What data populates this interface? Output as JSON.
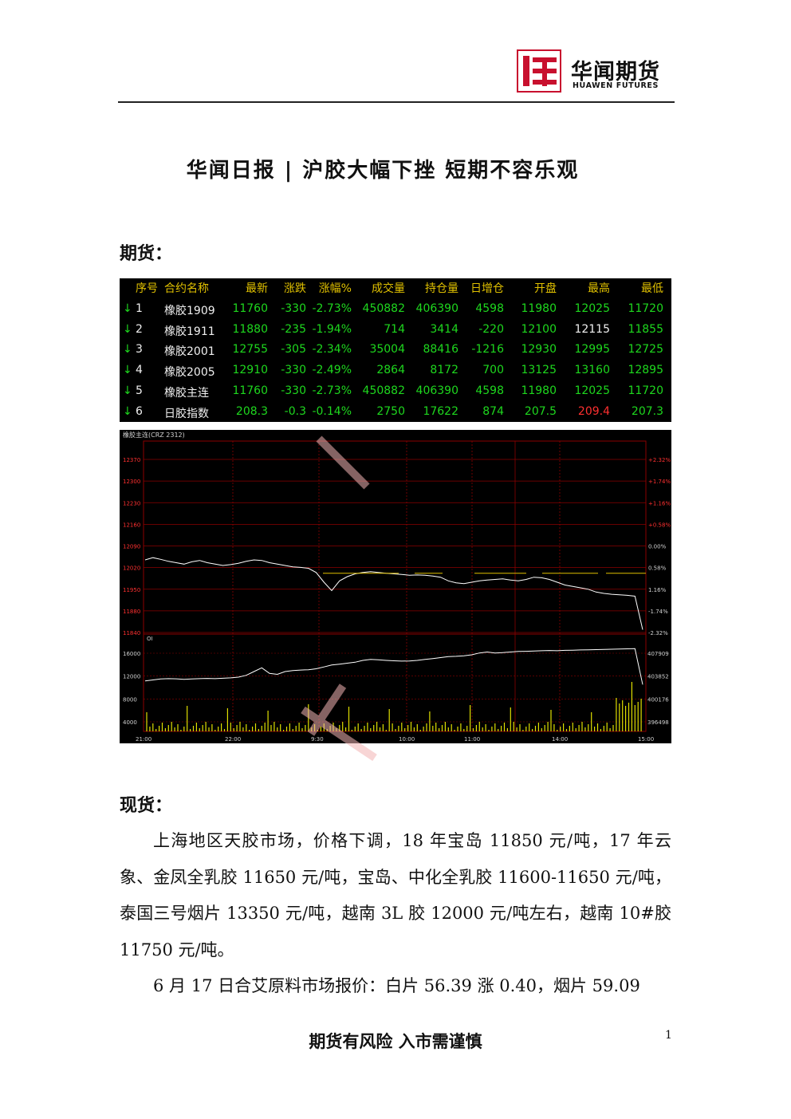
{
  "header": {
    "logo_cn": "华闻期货",
    "logo_en": "HUAWEN FUTURES",
    "brand_color": "#c8102e"
  },
  "title": "华闻日报 | 沪胶大幅下挫 短期不容乐观",
  "futures_heading": "期货：",
  "quote_table": {
    "columns": [
      "序号",
      "合约名称",
      "最新",
      "涨跌",
      "涨幅%",
      "成交量",
      "持仓量",
      "日增仓",
      "开盘",
      "最高",
      "最低"
    ],
    "rows": [
      {
        "arrow": "↓",
        "no": "1",
        "name": "橡胶1909",
        "last": "11760",
        "chg": "-330",
        "pct": "-2.73%",
        "vol": "450882",
        "oi": "406390",
        "doi": "4598",
        "open": "11980",
        "high": "12025",
        "low": "11720"
      },
      {
        "arrow": "↓",
        "no": "2",
        "name": "橡胶1911",
        "last": "11880",
        "chg": "-235",
        "pct": "-1.94%",
        "vol": "714",
        "oi": "3414",
        "doi": "-220",
        "open": "12100",
        "high": "12115",
        "low": "11855"
      },
      {
        "arrow": "↓",
        "no": "3",
        "name": "橡胶2001",
        "last": "12755",
        "chg": "-305",
        "pct": "-2.34%",
        "vol": "35004",
        "oi": "88416",
        "doi": "-1216",
        "open": "12930",
        "high": "12995",
        "low": "12725"
      },
      {
        "arrow": "↓",
        "no": "4",
        "name": "橡胶2005",
        "last": "12910",
        "chg": "-330",
        "pct": "-2.49%",
        "vol": "2864",
        "oi": "8172",
        "doi": "700",
        "open": "13125",
        "high": "13160",
        "low": "12895"
      },
      {
        "arrow": "↓",
        "no": "5",
        "name": "橡胶主连",
        "last": "11760",
        "chg": "-330",
        "pct": "-2.73%",
        "vol": "450882",
        "oi": "406390",
        "doi": "4598",
        "open": "11980",
        "high": "12025",
        "low": "11720"
      },
      {
        "arrow": "↓",
        "no": "6",
        "name": "日胶指数",
        "last": "208.3",
        "chg": "-0.3",
        "pct": "-0.14%",
        "vol": "2750",
        "oi": "17622",
        "doi": "874",
        "open": "207.5",
        "high": "209.4",
        "low": "207.3"
      }
    ],
    "colors": {
      "header": "#e0c000",
      "down": "#1ed81e",
      "up": "#ff3030",
      "flat": "#f0f0f0"
    }
  },
  "chart_data": {
    "type": "line",
    "title": "橡胶主连(CRZ 2312)",
    "price_ticks": [
      "12370",
      "12300",
      "12230",
      "12160",
      "12090",
      "12020",
      "11950",
      "11880",
      "11840"
    ],
    "pct_ticks": [
      "+2.32%",
      "+1.74%",
      "+1.16%",
      "+0.58%",
      "0.00%",
      "0.58%",
      "1.16%",
      "-1.74%",
      "-2.32%"
    ],
    "oi_label": "OI",
    "oi_ticks_left": [
      "16000",
      "12000",
      "8000",
      "4000"
    ],
    "oi_ticks_right": [
      "407909",
      "403852",
      "400176",
      "396498"
    ],
    "time_ticks": [
      "21:00",
      "22:00",
      "9:30",
      "10:00",
      "11:00",
      "14:00",
      "15:00"
    ],
    "price_ylim": [
      11750,
      12370
    ],
    "price": [
      12010,
      12018,
      12012,
      12005,
      12000,
      11995,
      12003,
      12008,
      12000,
      11995,
      11990,
      11993,
      11998,
      12005,
      12010,
      12008,
      12000,
      11995,
      11990,
      11985,
      11983,
      11980,
      11965,
      11930,
      11900,
      11935,
      11950,
      11960,
      11965,
      11968,
      11965,
      11962,
      11960,
      11958,
      11955,
      11956,
      11955,
      11952,
      11948,
      11935,
      11928,
      11925,
      11930,
      11935,
      11938,
      11940,
      11942,
      11938,
      11935,
      11940,
      11948,
      11946,
      11940,
      11930,
      11920,
      11915,
      11910,
      11905,
      11895,
      11890,
      11887,
      11885,
      11883,
      11880,
      11760
    ],
    "oi": [
      100,
      105,
      110,
      112,
      111,
      108,
      110,
      112,
      113,
      112,
      114,
      116,
      120,
      130,
      150,
      170,
      140,
      135,
      150,
      155,
      158,
      160,
      165,
      175,
      185,
      190,
      195,
      200,
      210,
      215,
      213,
      210,
      208,
      206,
      207,
      210,
      215,
      220,
      225,
      230,
      232,
      235,
      240,
      250,
      255,
      250,
      252,
      255,
      258,
      259,
      260,
      262,
      263,
      262,
      264,
      265,
      266,
      267,
      268,
      269,
      270,
      271,
      272,
      273,
      80
    ]
  },
  "spot_heading": "现货：",
  "paragraphs": [
    "上海地区天胶市场，价格下调，18 年宝岛 11850 元/吨，17 年云象、金凤全乳胶 11650 元/吨，宝岛、中化全乳胶 11600-11650 元/吨，泰国三号烟片 13350 元/吨，越南 3L 胶 12000 元/吨左右，越南 10#胶 11750 元/吨。",
    "6 月 17 日合艾原料市场报价：白片 56.39 涨 0.40，烟片 59.09"
  ],
  "footer": {
    "disclaimer": "期货有风险 入市需谨慎",
    "page_number": "1"
  }
}
